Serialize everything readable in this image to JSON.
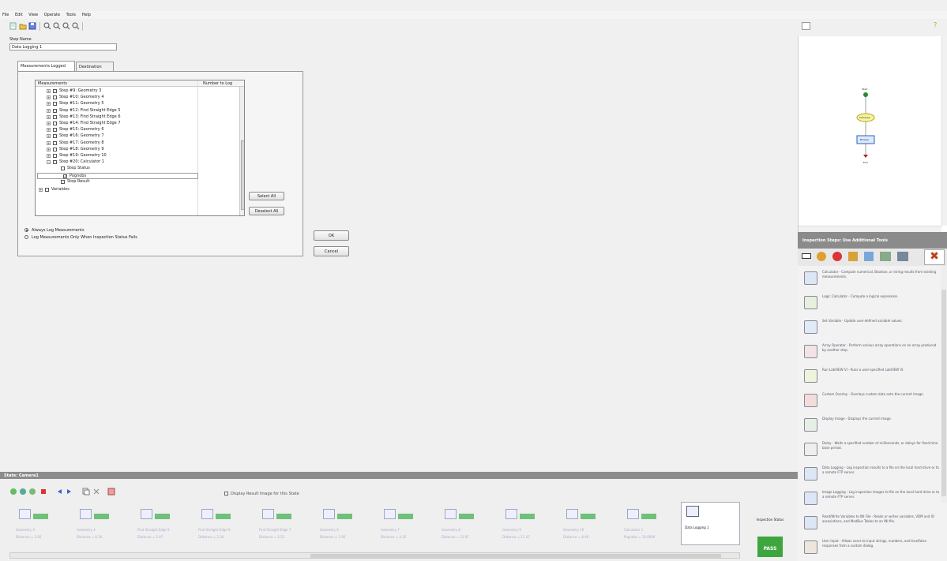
{
  "menu": [
    "File",
    "Edit",
    "View",
    "Operate",
    "Tools",
    "Help"
  ],
  "step": {
    "name_label": "Step Name",
    "name_value": "Data Logging 1"
  },
  "tabs": [
    "Measurements Logged",
    "Destination"
  ],
  "tree": {
    "col_measurements": "Measurements",
    "col_number": "Number to Log",
    "rows": [
      "Step #9: Geometry 3",
      "Step #10: Geometry 4",
      "Step #11: Geometry 5",
      "Step #12: Find Straight Edge 5",
      "Step #13: Find Straight Edge 6",
      "Step #14: Find Straight Edge 7",
      "Step #15: Geometry 6",
      "Step #16: Geometry 7",
      "Step #17: Geometry 8",
      "Step #18: Geometry 9",
      "Step #19: Geometry 10",
      "Step #20: Calculator 1"
    ],
    "children": [
      "Step Status",
      "Pognobs",
      "Step Result"
    ],
    "variables": "Variables"
  },
  "buttons": {
    "select_all": "Select All",
    "deselect_all": "Deselect All",
    "ok": "OK",
    "cancel": "Cancel"
  },
  "options": [
    "Always Log Measurements",
    "Log Measurements Only When Inspection Status Fails"
  ],
  "state_bar": "State: Camera1",
  "display_result": "Display Result Image for this State",
  "thumbnails": [
    {
      "name": "Geometry 3",
      "value": "Distance = 3.26"
    },
    {
      "name": "Geometry 4",
      "value": "Distance = 6.34"
    },
    {
      "name": "Find Straight Edge 5",
      "value": "Distance = 2.47"
    },
    {
      "name": "Find Straight Edge 6",
      "value": "Distance = 2.34"
    },
    {
      "name": "Find Straight Edge 7",
      "value": "Distance = 2.51"
    },
    {
      "name": "Geometry 6",
      "value": "Distance = 1.96"
    },
    {
      "name": "Geometry 7",
      "value": "Distance = 4.35"
    },
    {
      "name": "Geometry 8",
      "value": "Distance = 12.97"
    },
    {
      "name": "Geometry 9",
      "value": "Distance = 11.47"
    },
    {
      "name": "Geometry 10",
      "value": "Distance = 8.46"
    },
    {
      "name": "Calculator 1",
      "value": "Pognobs = 10.0000"
    }
  ],
  "current_thumb": "Data Logging 1",
  "inspection": {
    "label": "Inspection Status",
    "status": "PASS"
  },
  "flow": {
    "start": "Start",
    "step1": "Camera1",
    "step2": "Browse",
    "end": "End"
  },
  "right_panel": {
    "title": "Inspection Steps: Use Additional Tools",
    "tools": [
      "Calculator - Compute numerical, Boolean, or string results from existing measurements.",
      "Logic Calculator - Compute a logical expression.",
      "Set Variable - Update user-defined variable values.",
      "Array Operator - Perform various array operations on an array produced by another step.",
      "Run LabVIEW VI - Runs a user-specified LabVIEW VI.",
      "Custom Overlay - Overlays custom data onto the current image.",
      "Display Image - Displays the current image.",
      "Delay - Waits a specified number of milliseconds, or delays for fixed time base period.",
      "Data Logging - Log inspection results to a file on the local hard drive or to a remote FTP server.",
      "Image Logging - Log inspection images to file on the local hard drive or to a remote FTP server.",
      "Read/Write Variables to INI File - Reads or writes variables, VDM and IO associations, and ModBus Tables to an INI file.",
      "User Input - Allows users to input strings, numbers, and true/false responses from a custom dialog."
    ]
  },
  "colors": {
    "pass": "#3fa63f",
    "statebar": "#8c8c8c",
    "accent": "#2a63c7"
  }
}
